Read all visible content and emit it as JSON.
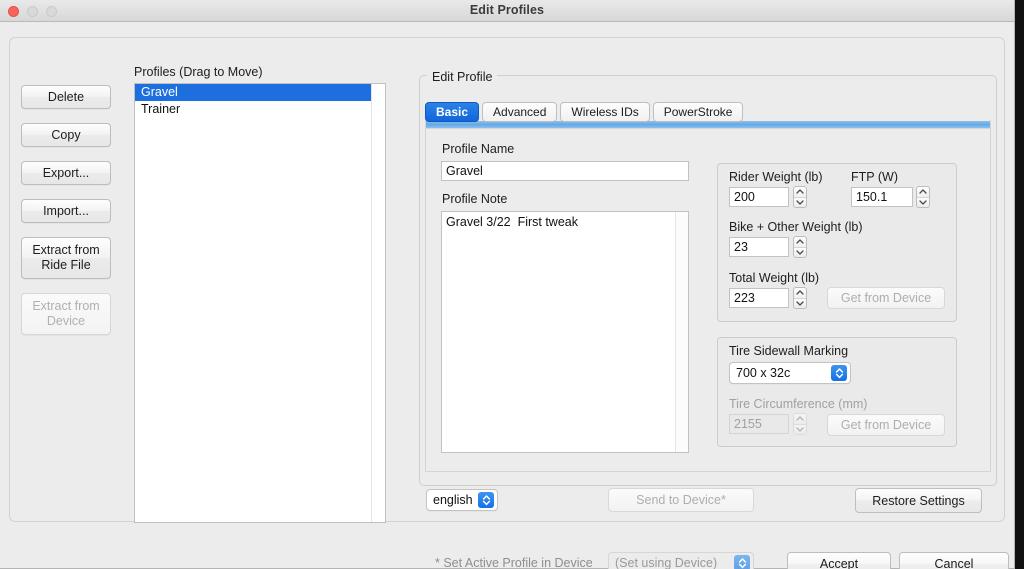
{
  "window": {
    "title": "Edit Profiles",
    "traffic_lights": [
      "close",
      "minimize",
      "zoom"
    ]
  },
  "sidebar": {
    "buttons": [
      {
        "label": "Delete",
        "enabled": true
      },
      {
        "label": "Copy",
        "enabled": true
      },
      {
        "label": "Export...",
        "enabled": true
      },
      {
        "label": "Import...",
        "enabled": true
      },
      {
        "label": "Extract from Ride File",
        "enabled": true
      },
      {
        "label": "Extract from Device",
        "enabled": false
      }
    ]
  },
  "profiles": {
    "label": "Profiles (Drag to Move)",
    "items": [
      {
        "name": "Gravel",
        "selected": true
      },
      {
        "name": "Trainer",
        "selected": false
      }
    ]
  },
  "edit_profile": {
    "group_title": "Edit Profile",
    "tabs": [
      {
        "label": "Basic",
        "active": true
      },
      {
        "label": "Advanced",
        "active": false
      },
      {
        "label": "Wireless IDs",
        "active": false
      },
      {
        "label": "PowerStroke",
        "active": false
      }
    ],
    "profile_name": {
      "label": "Profile Name",
      "value": "Gravel"
    },
    "profile_note": {
      "label": "Profile Note",
      "value": "Gravel 3/22  First tweak"
    },
    "weights": {
      "rider_weight": {
        "label": "Rider Weight (lb)",
        "value": "200",
        "enabled": true
      },
      "ftp": {
        "label": "FTP (W)",
        "value": "150.1",
        "enabled": true
      },
      "bike_weight": {
        "label": "Bike + Other Weight (lb)",
        "value": "23",
        "enabled": true
      },
      "total_weight": {
        "label": "Total Weight (lb)",
        "value": "223",
        "enabled": true
      },
      "get_from_device_button": {
        "label": "Get from Device",
        "enabled": false
      }
    },
    "tire": {
      "sidewall_label": "Tire Sidewall Marking",
      "sidewall_value": "700 x 32c",
      "circumference_label": "Tire Circumference (mm)",
      "circumference_value": "2155",
      "circumference_enabled": false,
      "get_from_device_button": {
        "label": "Get from Device",
        "enabled": false
      }
    },
    "footer": {
      "language_value": "english",
      "send_to_device": {
        "label": "Send to Device*",
        "enabled": false
      },
      "restore_settings": {
        "label": "Restore Settings",
        "enabled": true
      }
    }
  },
  "dialog_footer": {
    "active_profile_label": "* Set Active Profile in Device",
    "active_profile_value": "(Set using Device)",
    "accept_button": "Accept",
    "cancel_button": "Cancel"
  },
  "colors": {
    "selection_blue": "#1d6fe0",
    "accent_blue": "#1472e8",
    "window_bg": "#ececec",
    "close_red": "#f9655b"
  }
}
